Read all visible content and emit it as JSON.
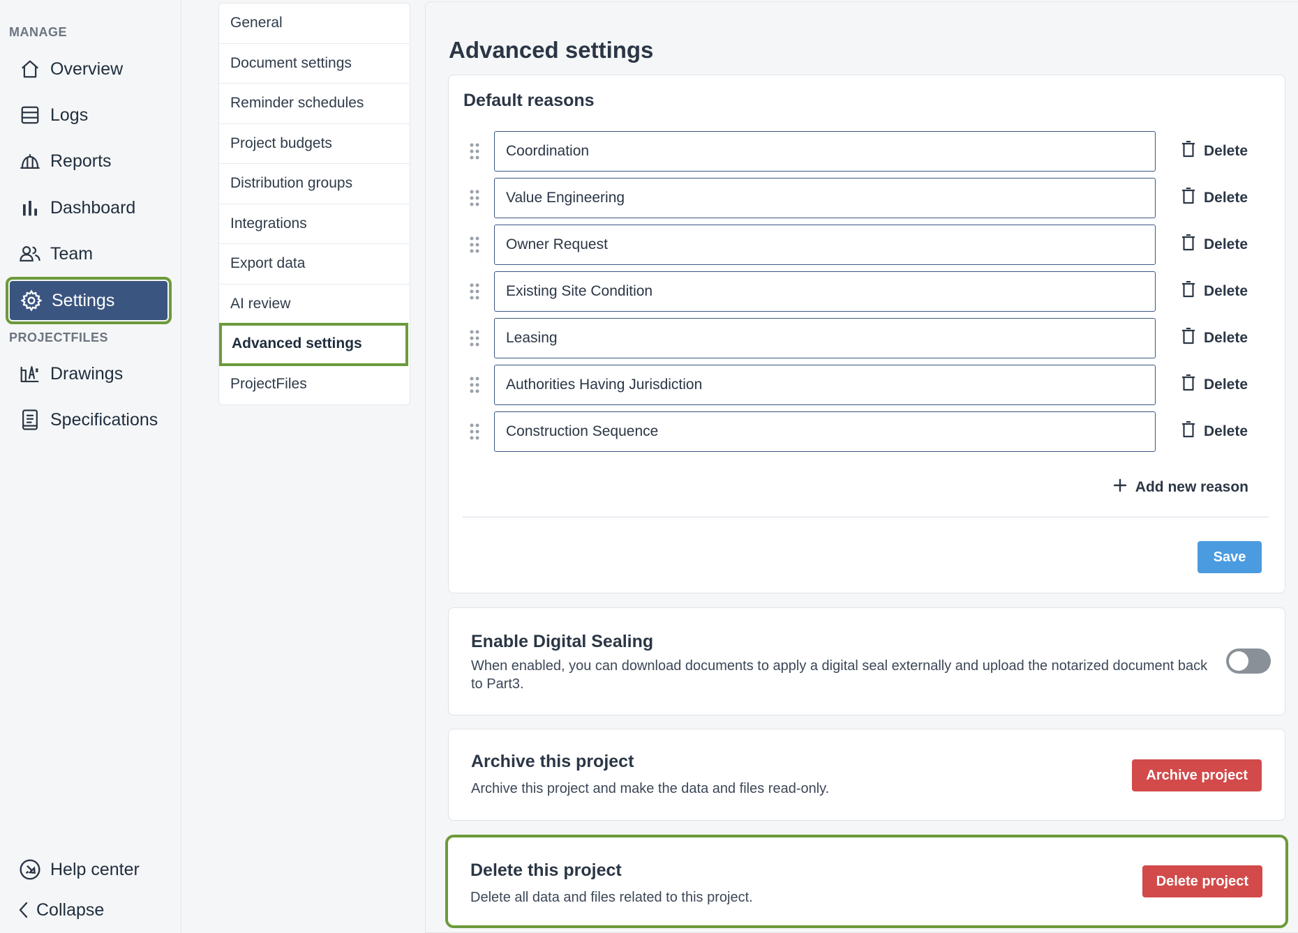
{
  "sidebar": {
    "manage_label": "MANAGE",
    "manage_items": [
      {
        "label": "Overview",
        "icon": "home-icon"
      },
      {
        "label": "Logs",
        "icon": "logs-icon"
      },
      {
        "label": "Reports",
        "icon": "reports-icon"
      },
      {
        "label": "Dashboard",
        "icon": "bar-chart-icon"
      },
      {
        "label": "Team",
        "icon": "team-icon"
      },
      {
        "label": "Settings",
        "icon": "gear-icon",
        "active": true
      }
    ],
    "projectfiles_label": "PROJECTFILES",
    "projectfiles_items": [
      {
        "label": "Drawings",
        "icon": "drawings-icon"
      },
      {
        "label": "Specifications",
        "icon": "document-icon"
      }
    ],
    "help_label": "Help center",
    "collapse_label": "Collapse"
  },
  "settings_menu": {
    "items": [
      "General",
      "Document settings",
      "Reminder schedules",
      "Project budgets",
      "Distribution groups",
      "Integrations",
      "Export data",
      "AI review",
      "Advanced settings",
      "ProjectFiles"
    ],
    "active": "Advanced settings"
  },
  "main": {
    "title": "Advanced settings",
    "default_reasons": {
      "title": "Default reasons",
      "reasons": [
        "Coordination",
        "Value Engineering",
        "Owner Request",
        "Existing Site Condition",
        "Leasing",
        "Authorities Having Jurisdiction",
        "Construction Sequence"
      ],
      "delete_label": "Delete",
      "add_label": "Add new reason",
      "save_label": "Save"
    },
    "digital_sealing": {
      "title": "Enable Digital Sealing",
      "description": "When enabled, you can download documents to apply a digital seal externally and upload the notarized document back to Part3.",
      "enabled": false
    },
    "archive": {
      "title": "Archive this project",
      "description": "Archive this project and make the data and files read-only.",
      "button_label": "Archive project"
    },
    "delete": {
      "title": "Delete this project",
      "description": "Delete all data and files related to this project.",
      "button_label": "Delete project"
    }
  },
  "colors": {
    "active_nav": "#3a5580",
    "highlight_outline": "#6c9a3b",
    "save_button": "#4b9be0",
    "danger_button": "#d24a4a"
  }
}
